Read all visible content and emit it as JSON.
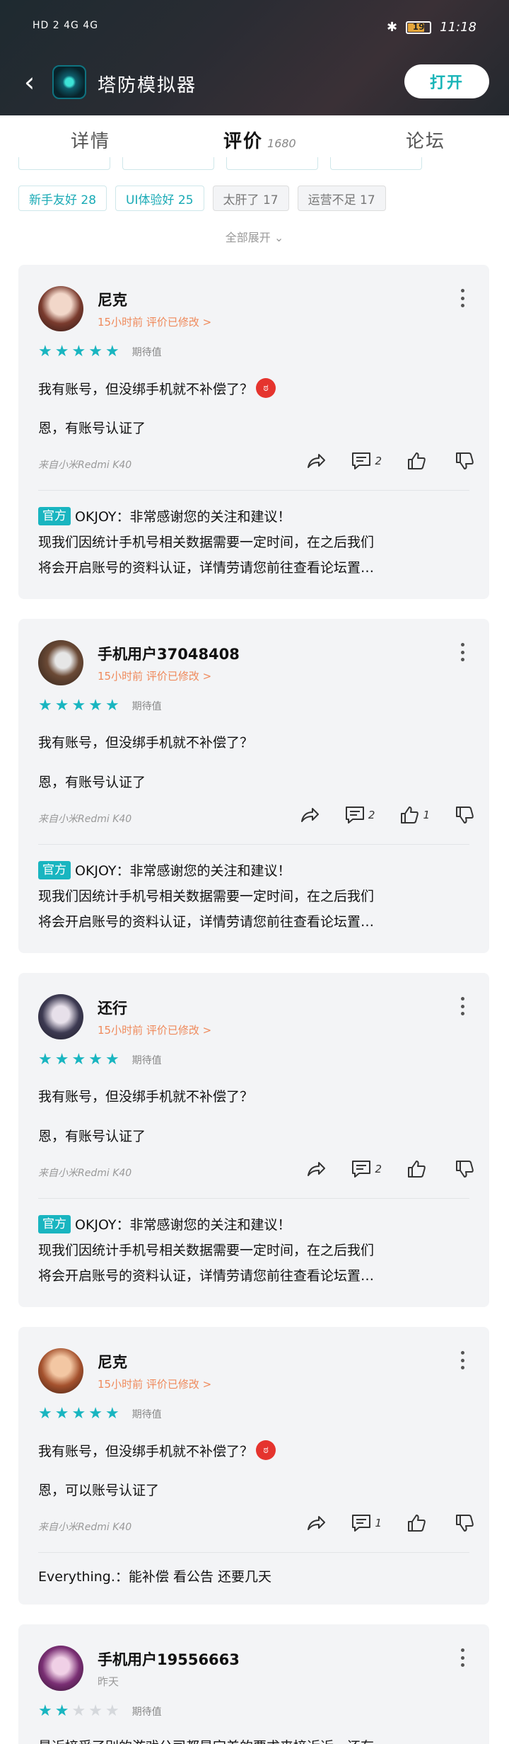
{
  "status_bar": {
    "left": "HD 2 4G 4G",
    "battery": "19",
    "time": "11:18"
  },
  "app": {
    "title": "塔防模拟器",
    "open_label": "打开"
  },
  "tabs": [
    {
      "label": "详情"
    },
    {
      "label": "评价",
      "count": "1680"
    },
    {
      "label": "论坛"
    }
  ],
  "tags": [
    {
      "label": "新手友好 28",
      "style": "teal"
    },
    {
      "label": "UI体验好 25",
      "style": "teal"
    },
    {
      "label": "太肝了 17",
      "style": "gray"
    },
    {
      "label": "运营不足 17",
      "style": "gray"
    }
  ],
  "expand_label": "全部展开",
  "common": {
    "rating_label": "期待值",
    "official_badge": "官方",
    "official_reply_1": "OKJOY：非常感谢您的关注和建议！",
    "official_reply_2": "现我们因统计手机号相关数据需要一定时间，在之后我们",
    "official_reply_3": "将会开启账号的资料认证，详情劳请您前往查看论坛置…"
  },
  "reviews": [
    {
      "name": "尼克",
      "time": "15小时前 评价已修改 >",
      "stars": 5,
      "text1": "我有账号，但没绑手机就不补偿了？",
      "emoji": true,
      "text2": "恩，有账号认证了",
      "device": "来自小米Redmi K40",
      "comments": "2",
      "likes": ""
    },
    {
      "name": "手机用户37048408",
      "time": "15小时前 评价已修改 >",
      "stars": 5,
      "text1": "我有账号，但没绑手机就不补偿了？",
      "emoji": false,
      "text2": "恩，有账号认证了",
      "device": "来自小米Redmi K40",
      "comments": "2",
      "likes": "1"
    },
    {
      "name": "还行",
      "time": "15小时前 评价已修改 >",
      "stars": 5,
      "text1": "我有账号，但没绑手机就不补偿了？",
      "emoji": false,
      "text2": "恩，有账号认证了",
      "device": "来自小米Redmi K40",
      "comments": "2",
      "likes": ""
    },
    {
      "name": "尼克",
      "time": "15小时前 评价已修改 >",
      "stars": 5,
      "text1": "我有账号，但没绑手机就不补偿了？",
      "emoji": true,
      "text2": "恩，可以账号认证了",
      "device": "来自小米Redmi K40",
      "comments": "1",
      "likes": "",
      "reply": "Everything.：能补偿 看公告 还要几天"
    },
    {
      "name": "手机用户19556663",
      "time": "昨天",
      "stars": 2,
      "text1": "最近接受了别的游戏公司都是定差的要求来接近近，还有"
    }
  ]
}
